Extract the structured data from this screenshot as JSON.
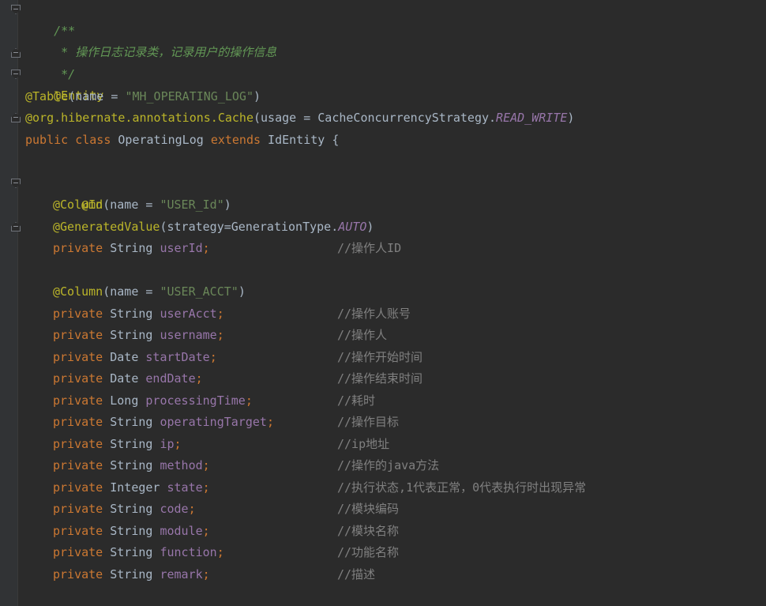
{
  "code": {
    "doc_open": "/**",
    "doc_text": " * 操作日志记录类，记录用户的操作信息",
    "doc_close": " */",
    "entity_annotation": "@Entity",
    "table_annotation": "@Table",
    "table_args_open": "(name = ",
    "table_name": "\"MH_OPERATING_LOG\"",
    "paren_close": ")",
    "cache_prefix": "@org.hibernate.annotations.",
    "cache_annotation": "Cache",
    "cache_args": "(usage = CacheConcurrencyStrategy.",
    "cache_strategy": "READ_WRITE",
    "class_public": "public",
    "class_kw": "class",
    "class_name": " OperatingLog ",
    "extends_kw": "extends",
    "parent_class": " IdEntity {",
    "id_annotation": "@Id",
    "column_annotation": "@Column",
    "column_args_open": "(name = ",
    "user_id_column": "\"USER_Id\"",
    "generated_annotation": "@GeneratedValue",
    "generated_args": "(strategy=GenerationType.",
    "generated_strategy": "AUTO",
    "user_acct_column": "\"USER_ACCT\"",
    "private_kw": "private"
  },
  "fields": [
    {
      "type": "String",
      "name": "userId",
      "comment": "//操作人ID"
    },
    {
      "type": "String",
      "name": "userAcct",
      "comment": "//操作人账号"
    },
    {
      "type": "String",
      "name": "username",
      "comment": "//操作人"
    },
    {
      "type": "Date",
      "name": "startDate",
      "comment": "//操作开始时间"
    },
    {
      "type": "Date",
      "name": "endDate",
      "comment": "//操作结束时间"
    },
    {
      "type": "Long",
      "name": "processingTime",
      "comment": "//耗时"
    },
    {
      "type": "String",
      "name": "operatingTarget",
      "comment": "//操作目标"
    },
    {
      "type": "String",
      "name": "ip",
      "comment": "//ip地址"
    },
    {
      "type": "String",
      "name": "method",
      "comment": "//操作的java方法"
    },
    {
      "type": "Integer",
      "name": "state",
      "comment": "//执行状态,1代表正常，0代表执行时出现异常"
    },
    {
      "type": "String",
      "name": "code",
      "comment": "//模块编码"
    },
    {
      "type": "String",
      "name": "module",
      "comment": "//模块名称"
    },
    {
      "type": "String",
      "name": "function",
      "comment": "//功能名称"
    },
    {
      "type": "String",
      "name": "remark",
      "comment": "//描述"
    }
  ],
  "colors": {
    "background": "#2b2b2b",
    "gutter": "#313335",
    "keyword": "#cc7832",
    "annotation": "#bbb529",
    "string": "#6a8759",
    "field": "#9876aa",
    "doc_comment": "#629755",
    "line_comment": "#808080",
    "default_text": "#a9b7c6"
  }
}
